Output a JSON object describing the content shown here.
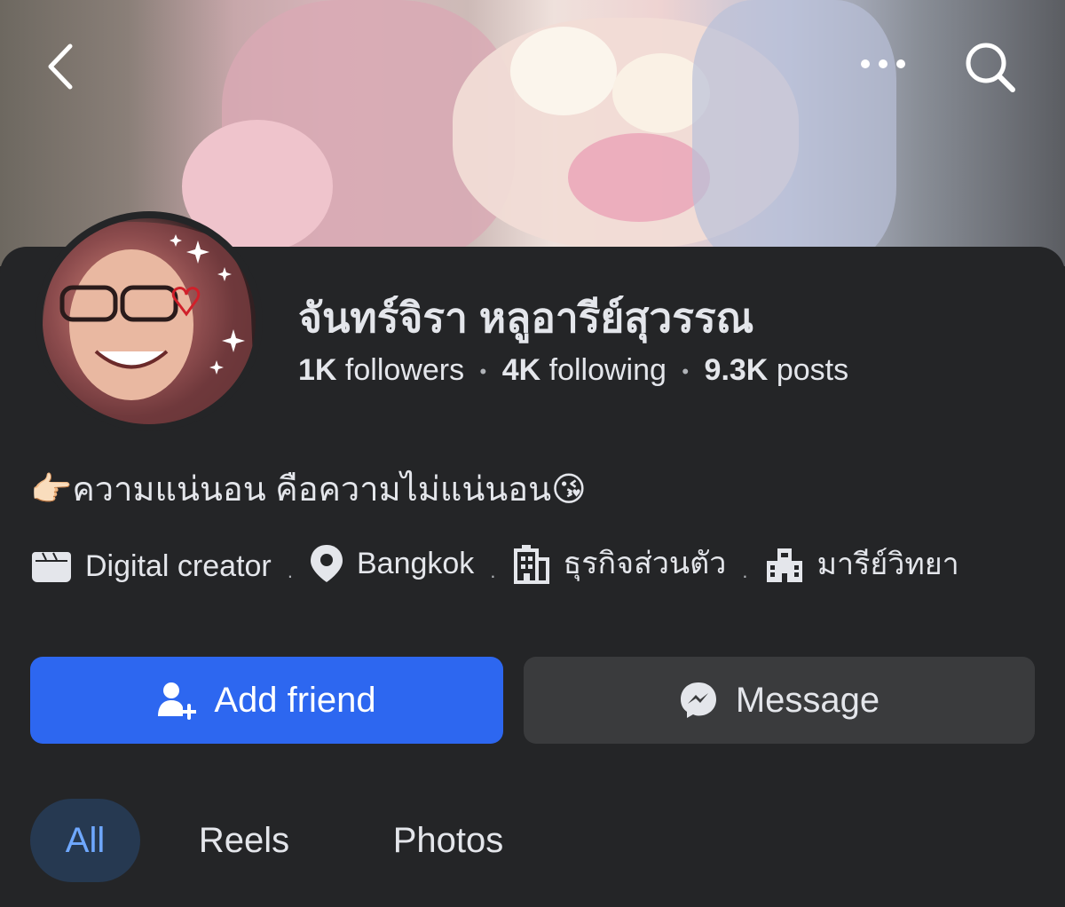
{
  "profile": {
    "name": "จันทร์จิรา หลูอารีย์สุวรรณ",
    "followers_count": "1K",
    "followers_label": "followers",
    "following_count": "4K",
    "following_label": "following",
    "posts_count": "9.3K",
    "posts_label": "posts",
    "bio_text": "ความแน่นอน คือความไม่แน่นอน",
    "bio_emoji_start": "👉🏻",
    "bio_emoji_end": "😘",
    "details": {
      "category": "Digital creator",
      "location": "Bangkok",
      "workplace": "ธุรกิจส่วนตัว",
      "school": "มารีย์วิทยา"
    }
  },
  "actions": {
    "add_friend": "Add friend",
    "message": "Message"
  },
  "tabs": [
    "All",
    "Reels",
    "Photos"
  ],
  "active_tab": "All",
  "colors": {
    "background": "#242527",
    "primary_button": "#2d67f0",
    "secondary_button": "#3a3b3d",
    "active_tab_bg": "#263951",
    "active_tab_text": "#6fa8ff"
  }
}
